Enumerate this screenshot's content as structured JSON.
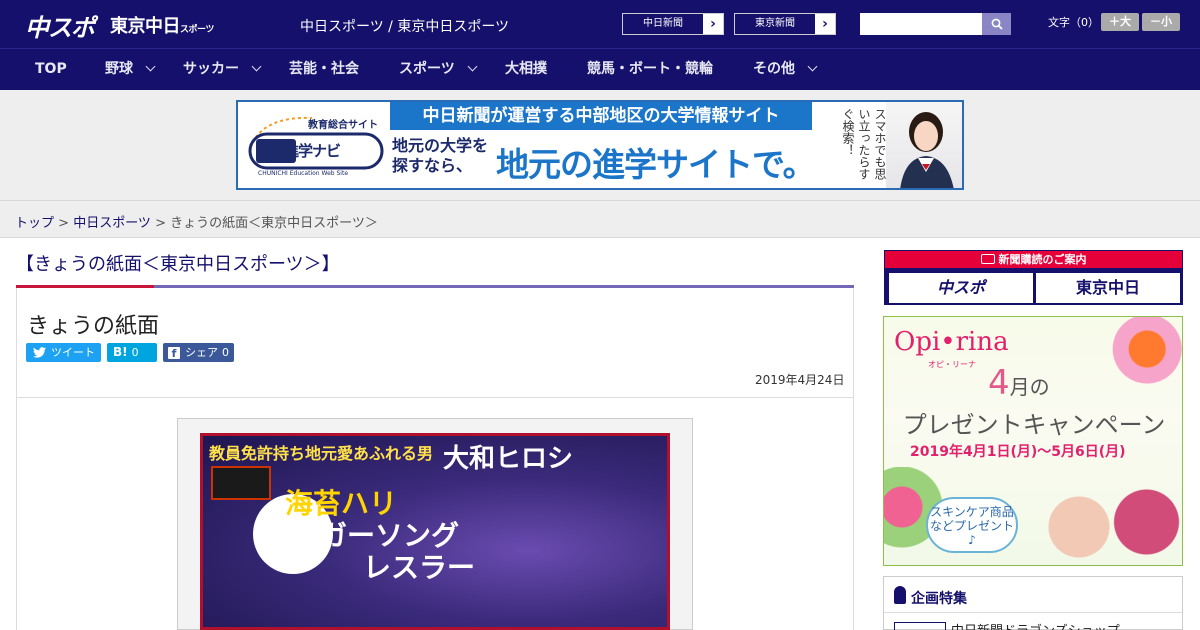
{
  "header": {
    "logo_primary": "中スポ",
    "logo_secondary": "東京中日",
    "logo_secondary_small": "スポーツ",
    "site_title": "中日スポーツ / 東京中日スポーツ",
    "paper_links": [
      "中日新聞",
      "東京新聞"
    ],
    "search_placeholder": "",
    "font_size_label": "文字（0）",
    "font_size_up": "＋大",
    "font_size_down": "－小"
  },
  "nav": {
    "items": [
      {
        "label": "TOP",
        "dropdown": false
      },
      {
        "label": "野球",
        "dropdown": true
      },
      {
        "label": "サッカー",
        "dropdown": true
      },
      {
        "label": "芸能・社会",
        "dropdown": false
      },
      {
        "label": "スポーツ",
        "dropdown": true
      },
      {
        "label": "大相撲",
        "dropdown": false
      },
      {
        "label": "競馬・ボート・競輪",
        "dropdown": false
      },
      {
        "label": "その他",
        "dropdown": true
      }
    ]
  },
  "banner": {
    "logo_caption": "教育総合サイト",
    "logo_name": "中日進学ナビ",
    "logo_sub": "CHUNICHI Education Web Site",
    "headline": "中日新聞が運営する中部地区の大学情報サイト",
    "left_text_1": "地元の大学を",
    "left_text_2": "探すなら、",
    "big_text": "地元の進学サイトで。",
    "vertical_text": "スマホでも思い立ったらすぐ検索！"
  },
  "breadcrumb": {
    "home": "トップ",
    "parent": "中日スポーツ",
    "current": "きょうの紙面＜東京中日スポーツ＞",
    "separator": " > "
  },
  "article": {
    "section_heading": "【きょうの紙面＜東京中日スポーツ＞】",
    "title": "きょうの紙面",
    "share": {
      "tweet_label": "ツイート",
      "hatena_icon": "B!",
      "hatena_count": "0",
      "facebook_label": "シェア",
      "facebook_count": "0"
    },
    "date": "2019年4月24日",
    "paper": {
      "kicker": "教員免許持ち地元愛あふれる男",
      "name": "大和ヒロシ",
      "headline_1": "海苔ハリ",
      "headline_2": "シンガーソング",
      "headline_3": "レスラー"
    }
  },
  "sidebar": {
    "subscribe_head": "新聞購読のご案内",
    "subscribe_logo_1": "中スポ",
    "subscribe_logo_2": "東京中日",
    "ad": {
      "brand": "Opi•rina",
      "brand_sub": "オピ・リーナ",
      "month_num": "4",
      "month_suffix": "月の",
      "campaign": "プレゼントキャンペーン",
      "range": "2019年4月1日(月)～5月6日(月)",
      "speech": "スキンケア商品などプレゼント♪"
    },
    "tokushu_head": "企画特集",
    "tokushu_item": "中日新聞ドラゴンズショップ"
  },
  "colors": {
    "brand_navy": "#15106b",
    "accent_red": "#e60039",
    "link": "#15106b",
    "twitter": "#1da1f2",
    "hatena": "#00a4de",
    "facebook": "#3b5998"
  }
}
